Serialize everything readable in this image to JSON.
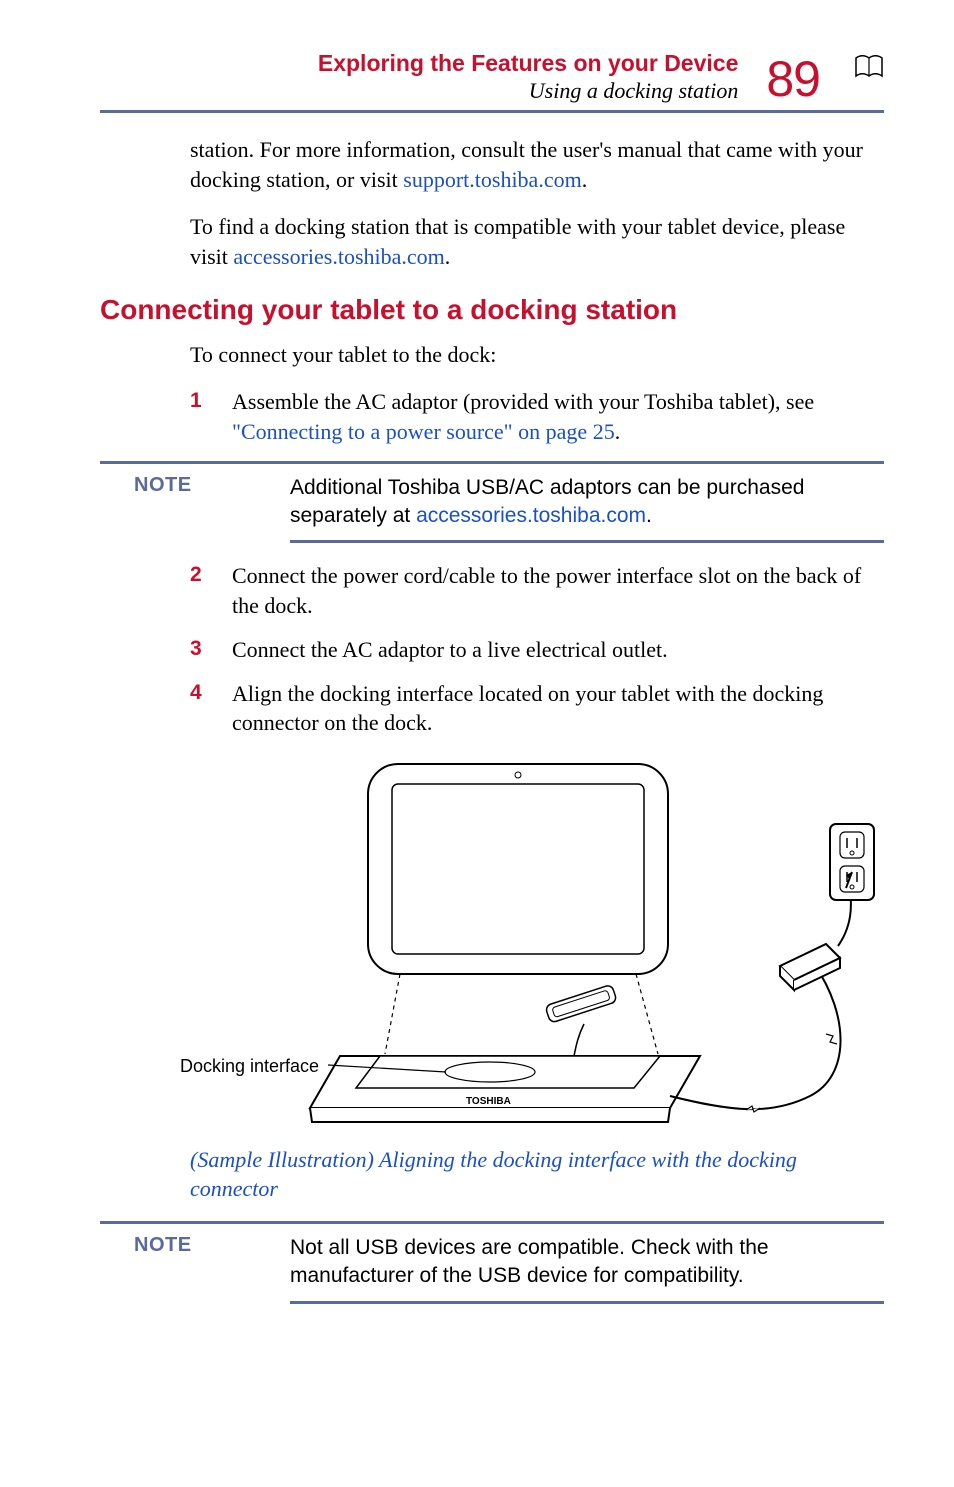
{
  "header": {
    "chapter": "Exploring the Features on your Device",
    "section": "Using a docking station",
    "page_number": "89"
  },
  "para_continuation": {
    "pre": "station. For more information, consult the user's manual that came with your docking station, or visit ",
    "link": "support.toshiba.com",
    "post": "."
  },
  "para_find": {
    "pre": "To find a docking station that is compatible with your tablet device, please visit ",
    "link": "accessories.toshiba.com",
    "post": "."
  },
  "heading2": "Connecting your tablet to a docking station",
  "intro": "To connect your tablet to the dock:",
  "steps": {
    "s1": {
      "num": "1",
      "pre": "Assemble the AC adaptor (provided with your Toshiba tablet), see ",
      "link": "\"Connecting to a power source\" on page 25",
      "post": "."
    },
    "s2": {
      "num": "2",
      "text": "Connect the power cord/cable to the power interface slot on the back of the dock."
    },
    "s3": {
      "num": "3",
      "text": "Connect the AC adaptor to a live electrical outlet."
    },
    "s4": {
      "num": "4",
      "text": "Align the docking interface located on your tablet with the docking connector on the dock."
    }
  },
  "note1": {
    "label": "NOTE",
    "pre": "Additional Toshiba USB/AC adaptors can be purchased separately at ",
    "link": "accessories.toshiba.com",
    "post": "."
  },
  "figure": {
    "callout_docking": "Docking interface",
    "caption": "(Sample Illustration) Aligning the docking interface with the docking connector"
  },
  "note2": {
    "label": "NOTE",
    "text": "Not all USB devices are compatible. Check with the manufacturer of the USB device for compatibility."
  }
}
